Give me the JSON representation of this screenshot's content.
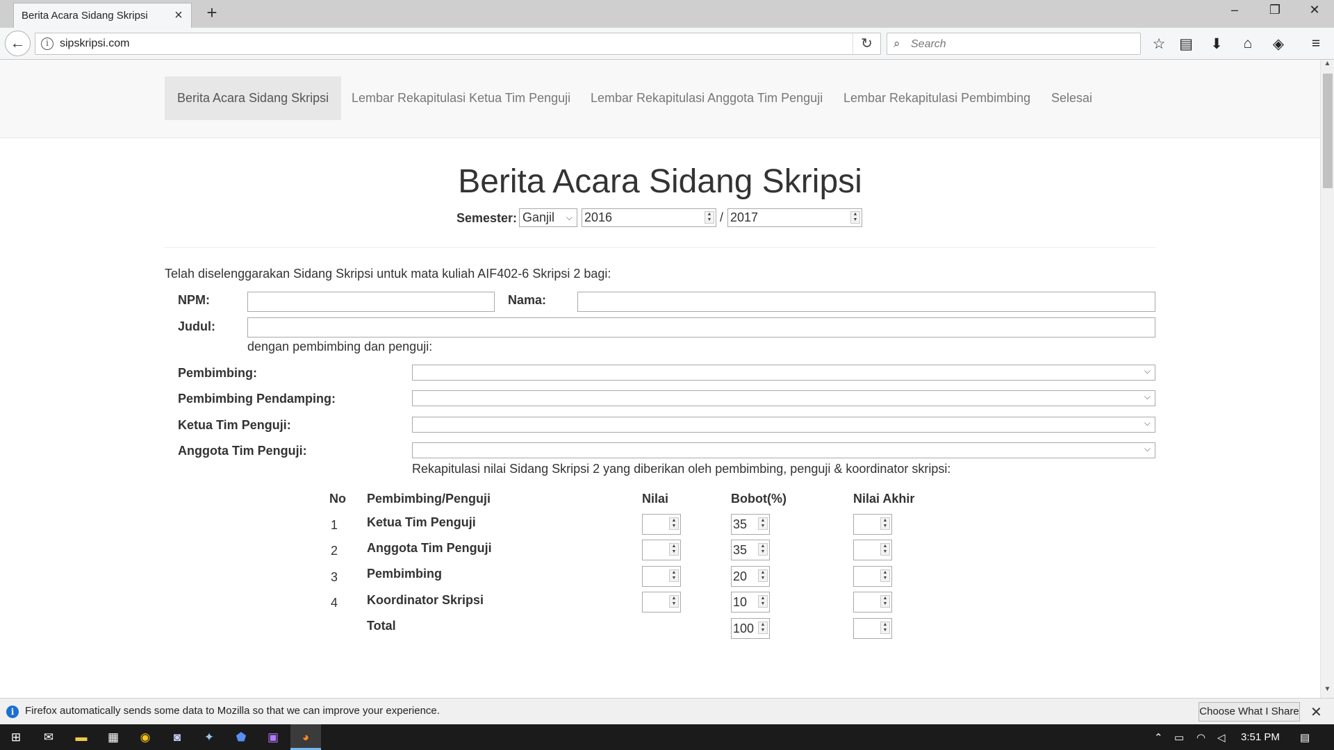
{
  "browser": {
    "tab_title": "Berita Acara Sidang Skripsi",
    "url": "sipskripsi.com",
    "search_placeholder": "Search",
    "notification_text": "Firefox automatically sends some data to Mozilla so that we can improve your experience.",
    "notification_button": "Choose What I Share"
  },
  "nav": {
    "items": [
      {
        "label": "Berita Acara Sidang Skripsi",
        "active": true
      },
      {
        "label": "Lembar Rekapitulasi Ketua Tim Penguji"
      },
      {
        "label": "Lembar Rekapitulasi Anggota Tim Penguji"
      },
      {
        "label": "Lembar Rekapitulasi Pembimbing"
      },
      {
        "label": "Selesai"
      }
    ]
  },
  "form": {
    "title": "Berita Acara Sidang Skripsi",
    "semester_label": "Semester:",
    "semester_value": "Ganjil",
    "year_start": "2016",
    "year_sep": "/",
    "year_end": "2017",
    "intro": "Telah diselenggarakan Sidang Skripsi untuk mata kuliah AIF402-6 Skripsi 2 bagi:",
    "npm_label": "NPM:",
    "nama_label": "Nama:",
    "judul_label": "Judul:",
    "pembimbing_note": "dengan pembimbing dan penguji:",
    "pembimbing_label": "Pembimbing:",
    "pendamping_label": "Pembimbing Pendamping:",
    "ketua_label": "Ketua Tim Penguji:",
    "anggota_label": "Anggota Tim Penguji:",
    "rekap_note": "Rekapitulasi nilai Sidang Skripsi 2 yang diberikan oleh pembimbing, penguji & koordinator skripsi:"
  },
  "table": {
    "headers": {
      "no": "No",
      "role": "Pembimbing/Penguji",
      "nilai": "Nilai",
      "bobot": "Bobot(%)",
      "akhir": "Nilai Akhir"
    },
    "rows": [
      {
        "no": "1",
        "role": "Ketua Tim Penguji",
        "bobot": "35"
      },
      {
        "no": "2",
        "role": "Anggota Tim Penguji",
        "bobot": "35"
      },
      {
        "no": "3",
        "role": "Pembimbing",
        "bobot": "20"
      },
      {
        "no": "4",
        "role": "Koordinator Skripsi",
        "bobot": "10"
      }
    ],
    "total_label": "Total",
    "total_bobot": "100"
  },
  "taskbar": {
    "time": "3:51 PM"
  }
}
